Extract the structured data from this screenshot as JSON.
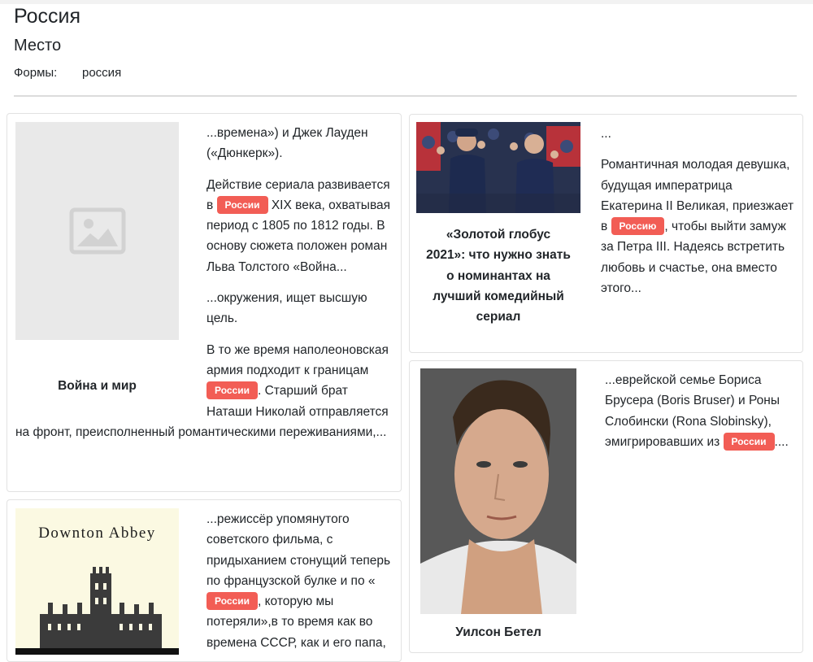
{
  "header": {
    "title": "Россия",
    "type": "Место",
    "forms_label": "Формы:",
    "forms_value": "россия"
  },
  "cards": [
    {
      "media_title": "Война и мир",
      "parts": [
        "...времена») и Джек Лауден («Дюнкерк»).",
        "Действие сериала развивается в",
        "России",
        "XIX века, охватывая период с 1805 по 1812 годы. В основу сюжета положен роман Льва Толстого «Война...",
        "...окружения, ищет высшую цель.",
        "В то же время наполеоновская армия подходит к границам",
        "России",
        ". Старший брат Наташи Николай отправляется на фронт, преисполненный романтическими переживаниями,..."
      ]
    },
    {
      "media_title": "«Золотой глобус 2021»: что нужно знать о номинантах на лучший комедийный сериал",
      "parts": [
        "...",
        "Романтичная молодая девушка, будущая императрица Екатерина II Великая, приезжает в",
        "Россию",
        ", чтобы выйти замуж за Петра III. Надеясь встретить любовь и счастье, она вместо этого..."
      ]
    },
    {
      "media_title": "Уилсон Бетел",
      "parts": [
        "...еврейской семье Бориса Брусера (Boris Bruser) и Роны Слобински (Rona Slobinsky), эмигрировавших из",
        "России",
        "...."
      ]
    },
    {
      "media_image_text": "Downton Abbey",
      "parts": [
        "...режиссёр упомянутого советского фильма, с придыханием стонущий теперь по французской булке и по «",
        "России",
        ", которую мы потеряли»,в то время как во времена СССР, как и его папа,"
      ]
    }
  ],
  "colors": {
    "badge": "#f25d55",
    "border": "#e2e2e2",
    "placeholder": "#e9e9e9"
  }
}
